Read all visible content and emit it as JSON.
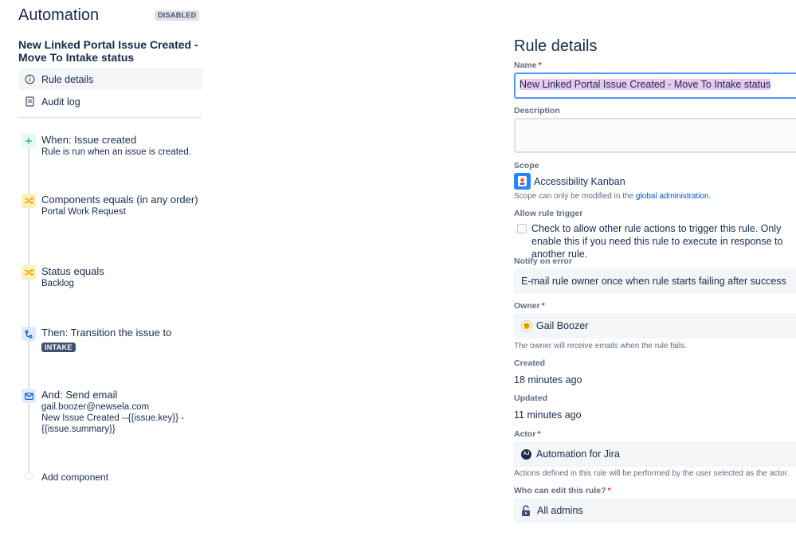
{
  "header": {
    "title": "Automation",
    "status_badge": "DISABLED"
  },
  "rule": {
    "title": "New Linked Portal Issue Created - Move To Intake status"
  },
  "nav": {
    "items": [
      {
        "label": "Rule details",
        "icon": "info-icon"
      },
      {
        "label": "Audit log",
        "icon": "document-icon"
      }
    ]
  },
  "components": [
    {
      "title": "When: Issue created",
      "lines": [
        "Rule is run when an issue is created."
      ],
      "icon": "plus-icon",
      "color": "#36b37e"
    },
    {
      "title": "Components equals (in any order)",
      "lines": [
        "Portal Work Request"
      ],
      "icon": "shuffle-icon",
      "color": "#ff991f"
    },
    {
      "title": "Status equals",
      "lines": [
        "Backlog"
      ],
      "icon": "shuffle-icon",
      "color": "#ff991f"
    },
    {
      "title": "Then: Transition the issue to",
      "lozenge": "INTAKE",
      "icon": "transition-icon",
      "color": "#0052cc"
    },
    {
      "title": "And: Send email",
      "lines": [
        "gail.boozer@newsela.com",
        "New Issue Created --{{issue.key}} - {{issue.summary}}"
      ],
      "icon": "mail-icon",
      "color": "#0052cc"
    }
  ],
  "add_component": {
    "label": "Add component"
  },
  "details": {
    "heading": "Rule details",
    "name": {
      "label": "Name",
      "value": "New Linked Portal Issue Created - Move To Intake status"
    },
    "description": {
      "label": "Description",
      "value": ""
    },
    "scope": {
      "label": "Scope",
      "value": "Accessibility Kanban",
      "helper_prefix": "Scope can only be modified in the ",
      "helper_link": "global administration",
      "helper_suffix": "."
    },
    "allow_trigger": {
      "label": "Allow rule trigger",
      "checkbox_text": "Check to allow other rule actions to trigger this rule. Only enable this if you need this rule to execute in response to another rule.",
      "checked": false
    },
    "notify": {
      "label": "Notify on error",
      "value": "E-mail rule owner once when rule starts failing after success"
    },
    "owner": {
      "label": "Owner",
      "value": "Gail Boozer",
      "helper": "The owner will receive emails when the rule fails."
    },
    "created": {
      "label": "Created",
      "value": "18 minutes ago"
    },
    "updated": {
      "label": "Updated",
      "value": "11 minutes ago"
    },
    "actor": {
      "label": "Actor",
      "value": "Automation for Jira",
      "avatar_text": "AJ",
      "helper": "Actions defined in this rule will be performed by the user selected as the actor."
    },
    "editors": {
      "label": "Who can edit this rule?",
      "value": "All admins"
    }
  },
  "colors": {
    "accent": "#0052cc",
    "required": "#de350b",
    "selection": "#e7c8ef",
    "focus_border": "#4c9aff"
  }
}
